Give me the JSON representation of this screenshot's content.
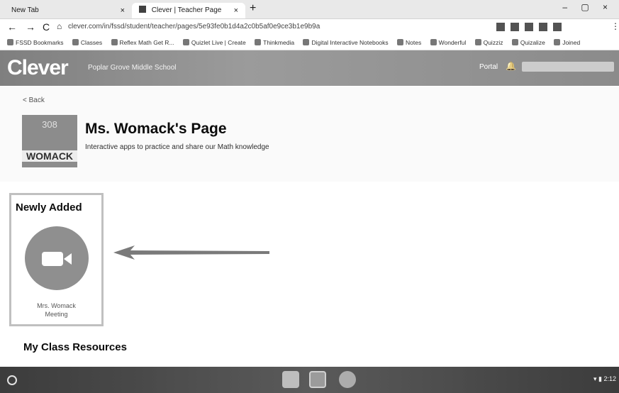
{
  "browser": {
    "tabs": [
      {
        "label": "New Tab",
        "close": "×"
      },
      {
        "label": "Clever | Teacher Page",
        "close": "×"
      }
    ],
    "new_tab": "+",
    "window_controls": "– ▢ ×",
    "url": "clever.com/in/fssd/student/teacher/pages/5e93fe0b1d4a2c0b5af0e9ce3b1e9b9a",
    "bookmarks": [
      "FSSD Bookmarks",
      "Classes",
      "Reflex Math Get R...",
      "Quizlet Live | Create",
      "Thinkmedia",
      "Digital Interactive Notebooks",
      "Notes",
      "Wonderful",
      "Quizziz",
      "Quizalize",
      "Joined"
    ]
  },
  "clever": {
    "logo": "Clever",
    "school": "Poplar Grove Middle School",
    "portal": "Portal"
  },
  "page": {
    "back": "< Back",
    "avatar_number": "308",
    "avatar_name": "WOMACK",
    "title": "Ms. Womack's Page",
    "subtitle": "Interactive apps to practice and share our Math knowledge"
  },
  "newly_added": {
    "heading": "Newly Added",
    "app_label_line1": "Mrs. Womack",
    "app_label_line2": "Meeting"
  },
  "section_heading": "My Class Resources",
  "taskbar": {
    "time": "2:12"
  }
}
